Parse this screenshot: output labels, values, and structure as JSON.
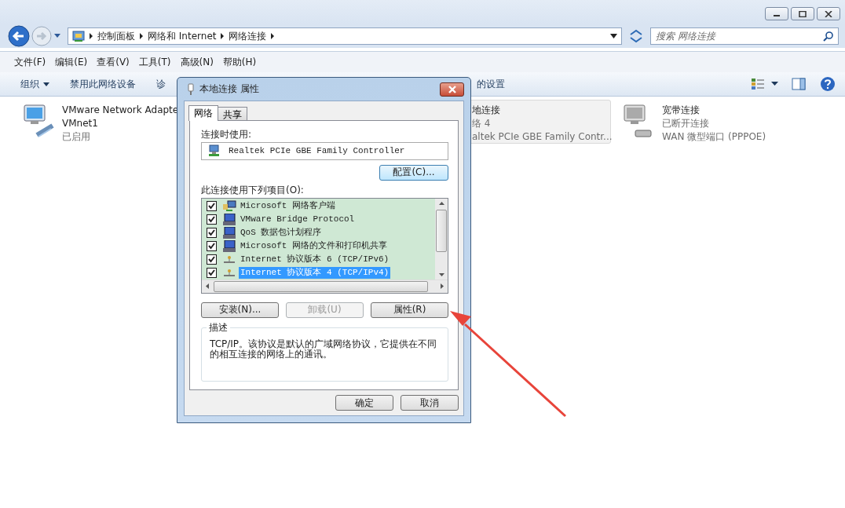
{
  "address_bar": {
    "path": [
      "控制面板",
      "网络和 Internet",
      "网络连接"
    ]
  },
  "search": {
    "placeholder": "搜索 网络连接"
  },
  "menu": [
    "文件(F)",
    "编辑(E)",
    "查看(V)",
    "工具(T)",
    "高级(N)",
    "帮助(H)"
  ],
  "toolbar": [
    {
      "label": "组织",
      "kind": "dropdown"
    },
    {
      "label": "禁用此网络设备",
      "kind": "button"
    },
    {
      "label": "诊",
      "kind": "button"
    },
    {
      "label": "的设置",
      "kind": "gap-button"
    }
  ],
  "connections": [
    {
      "kind": "lan",
      "selected": false,
      "lines": [
        "VMware Network Adapte",
        "VMnet1",
        "已启用"
      ]
    },
    {
      "kind": "covered",
      "selected": true,
      "lines": [
        "地连接",
        "络 4",
        "altek PCIe GBE Family Contr..."
      ]
    },
    {
      "kind": "broadband",
      "selected": false,
      "lines": [
        "宽带连接",
        "已断开连接",
        "WAN 微型端口 (PPPOE)"
      ]
    }
  ],
  "dialog": {
    "title": "本地连接 属性",
    "tabs": [
      {
        "label": "网络",
        "selected": true
      },
      {
        "label": "共享",
        "selected": false
      }
    ],
    "connect_using_label": "连接时使用:",
    "adapter": "Realtek PCIe GBE Family Controller",
    "configure_button": "配置(C)...",
    "items_label": "此连接使用下列项目(O):",
    "items": [
      {
        "kind": "client",
        "label": "Microsoft 网络客户端",
        "checked": true,
        "selected": false
      },
      {
        "kind": "service",
        "label": "VMware Bridge Protocol",
        "checked": true,
        "selected": false
      },
      {
        "kind": "service",
        "label": "QoS 数据包计划程序",
        "checked": true,
        "selected": false
      },
      {
        "kind": "service",
        "label": "Microsoft 网络的文件和打印机共享",
        "checked": true,
        "selected": false
      },
      {
        "kind": "protocol",
        "label": "Internet 协议版本 6 (TCP/IPv6)",
        "checked": true,
        "selected": false
      },
      {
        "kind": "protocol",
        "label": "Internet 协议版本 4 (TCP/IPv4)",
        "checked": true,
        "selected": true
      }
    ],
    "buttons": [
      {
        "label": "安装(N)...",
        "disabled": false
      },
      {
        "label": "卸载(U)",
        "disabled": true
      },
      {
        "label": "属性(R)",
        "disabled": false
      }
    ],
    "description_label": "描述",
    "description": "TCP/IP。该协议是默认的广域网络协议，它提供在不同的相互连接的网络上的通讯。",
    "footer_buttons": [
      "确定",
      "取消"
    ]
  }
}
